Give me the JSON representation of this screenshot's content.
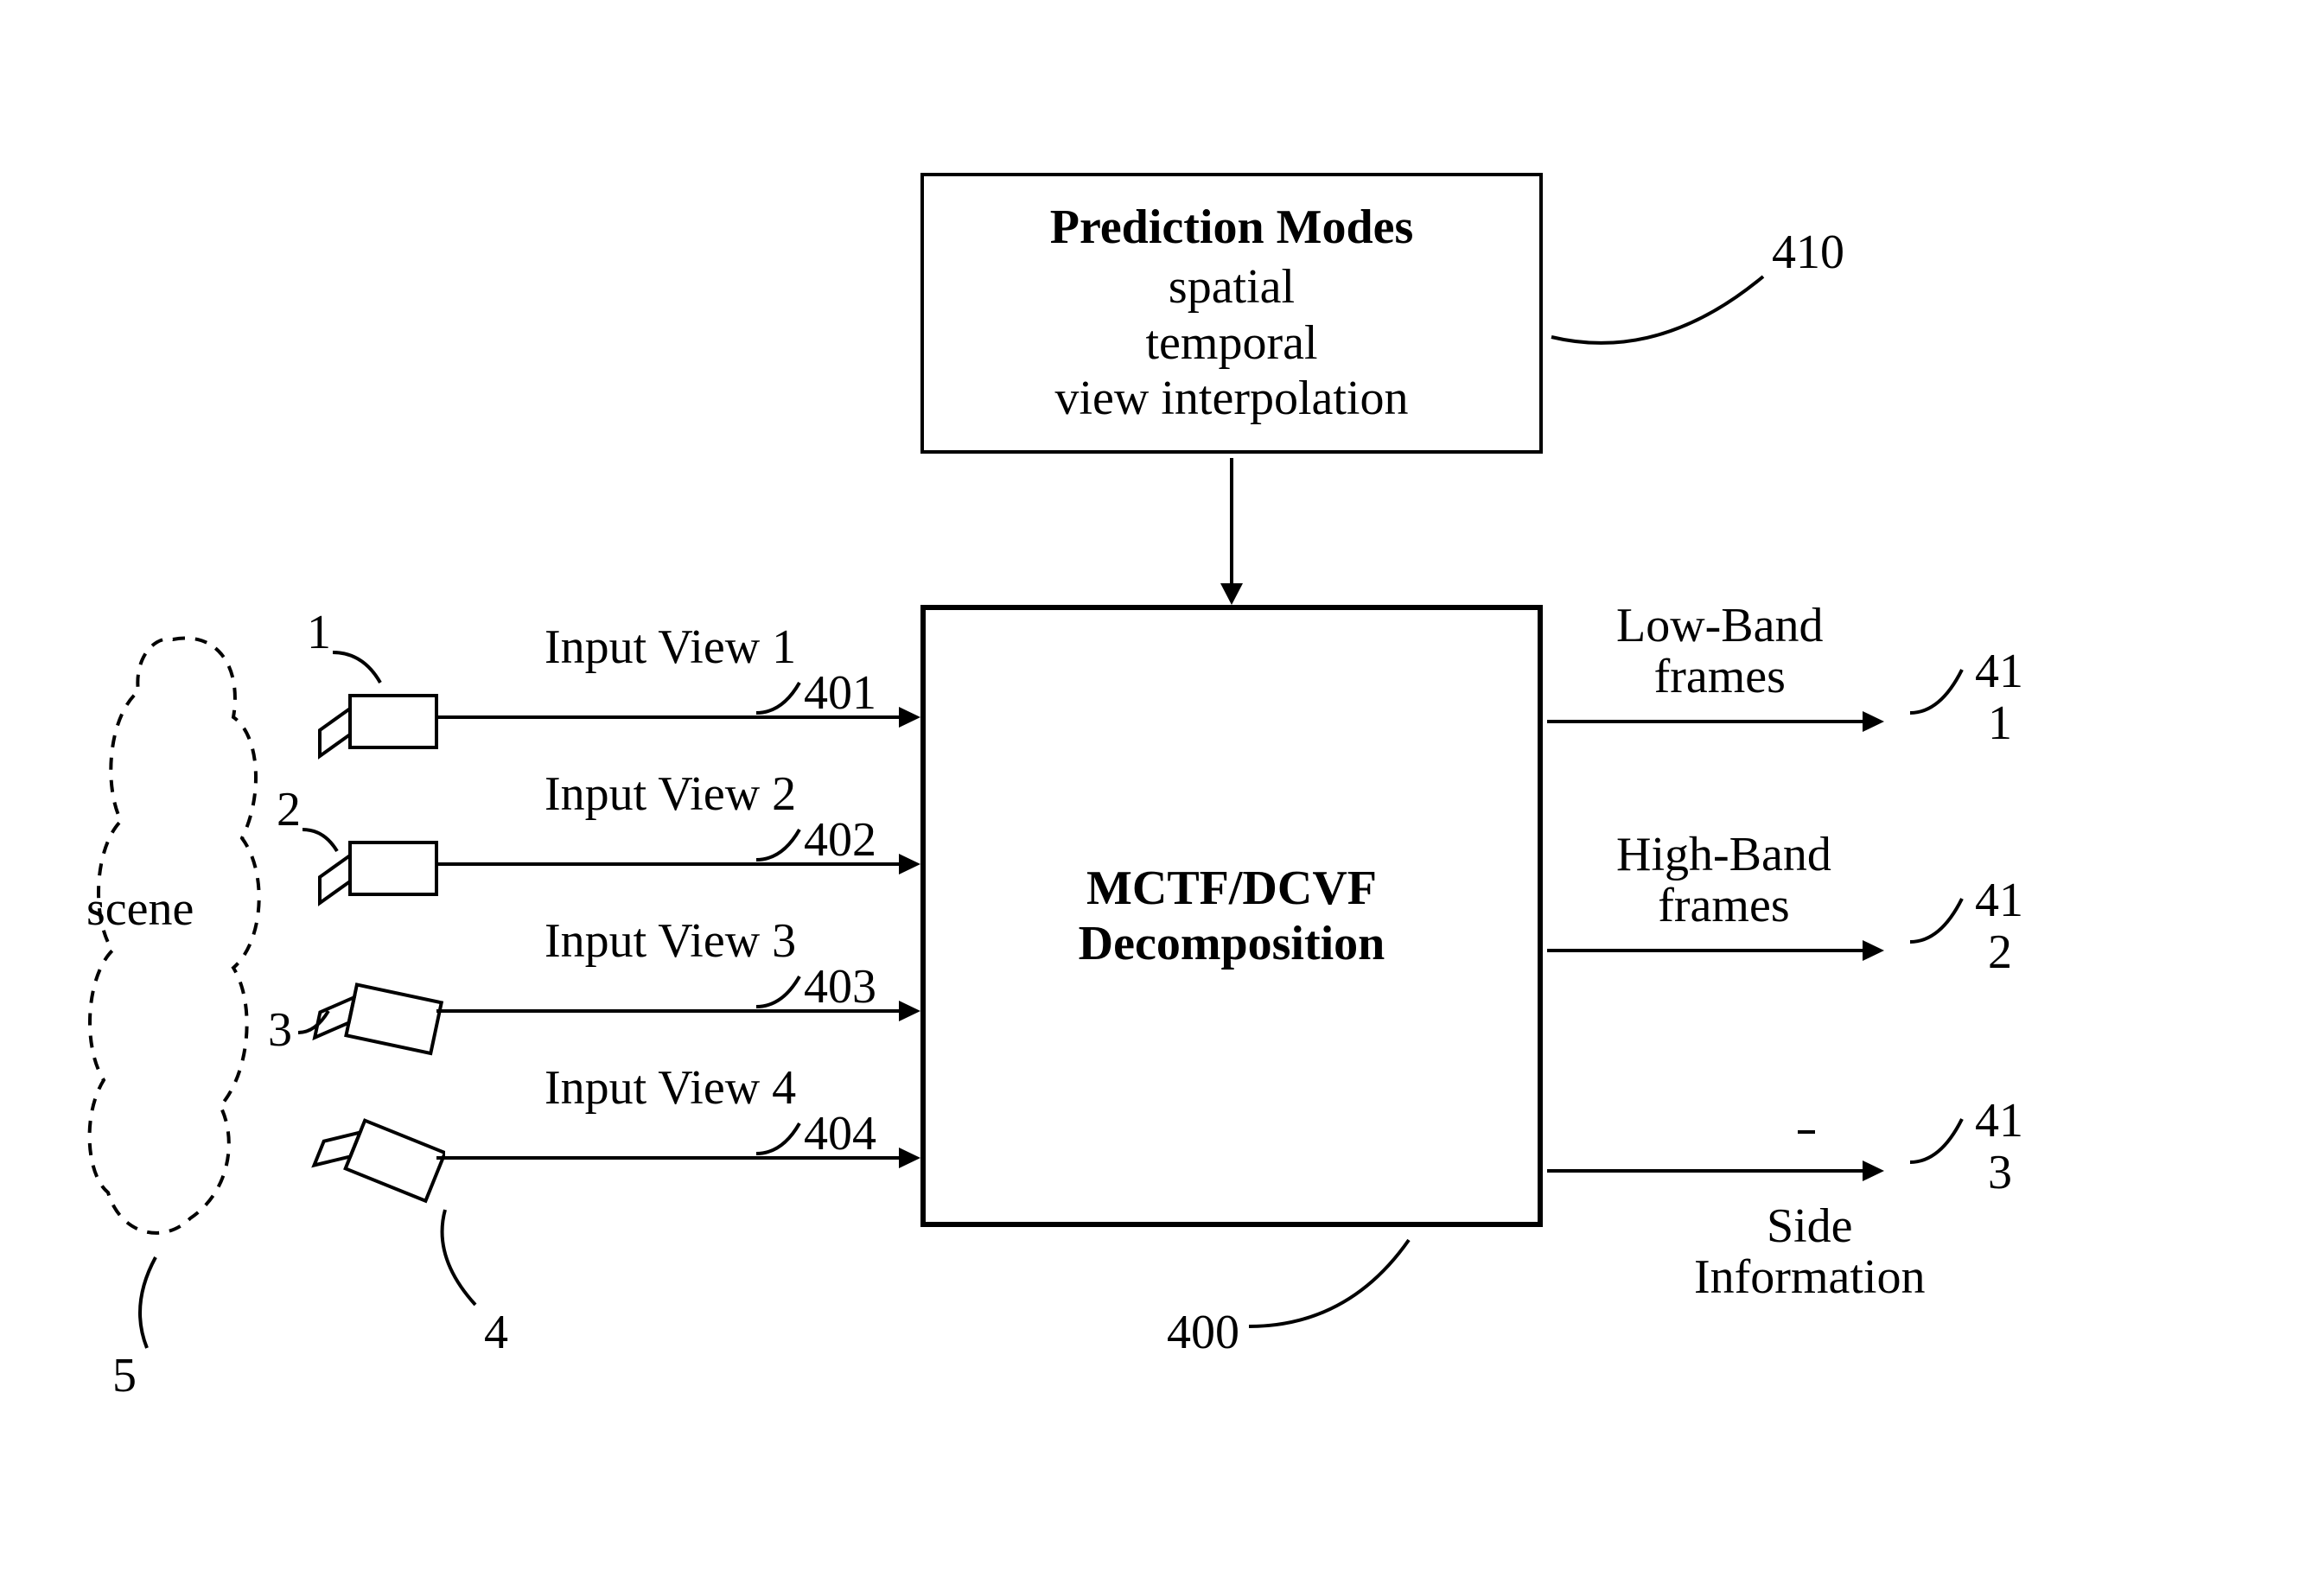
{
  "prediction_box": {
    "title": "Prediction Modes",
    "line1": "spatial",
    "line2": "temporal",
    "line3": "view interpolation"
  },
  "main_box": {
    "line1": "MCTF/DCVF",
    "line2": "Decomposition"
  },
  "scene": {
    "label": "scene"
  },
  "inputs": {
    "view1": "Input View 1",
    "view2": "Input View 2",
    "view3": "Input View 3",
    "view4": "Input View 4"
  },
  "outputs": {
    "lowband": "Low-Band\nframes",
    "highband": "High-Band\nframes",
    "sideinfo": "Side\nInformation"
  },
  "refs": {
    "cam1": "1",
    "cam2": "2",
    "cam3": "3",
    "cam4": "4",
    "scene": "5",
    "view1": "401",
    "view2": "402",
    "view3": "403",
    "view4": "404",
    "main": "400",
    "prediction": "410",
    "out1a": "41",
    "out1b": "1",
    "out2a": "41",
    "out2b": "2",
    "out3a": "41",
    "out3b": "3"
  }
}
